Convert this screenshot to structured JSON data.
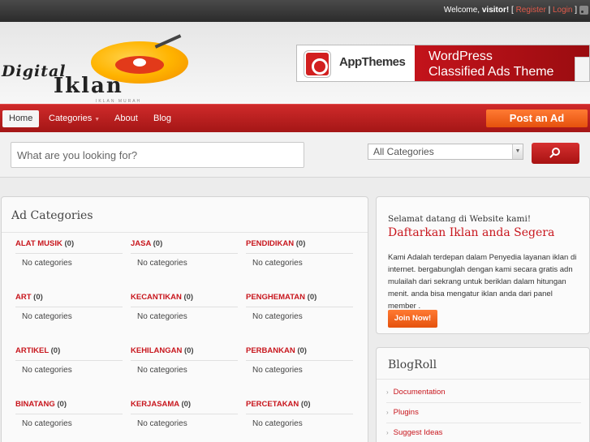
{
  "topbar": {
    "welcome_prefix": "Welcome, ",
    "username": "visitor!",
    "register_label": "Register",
    "login_label": "Login",
    "rss_icon": "rss-icon"
  },
  "logo": {
    "line1": "Digital",
    "line2": "Iklan",
    "tagline": "IKLAN MURAH"
  },
  "banner": {
    "brand": "AppThemes",
    "line1": "WordPress",
    "line2": "Classified Ads Theme"
  },
  "nav": {
    "items": [
      "Home",
      "Categories",
      "About",
      "Blog"
    ],
    "post_ad": "Post an Ad",
    "colors": {
      "nav_red": "#c0161d",
      "orange": "#f36a22"
    }
  },
  "search": {
    "placeholder": "What are you looking for?",
    "category_selected": "All Categories",
    "search_icon": "search-icon"
  },
  "categories": {
    "title": "Ad Categories",
    "columns": [
      [
        {
          "name": "ALAT MUSIK",
          "count": "(0)",
          "sub": "No categories"
        },
        {
          "name": "ART",
          "count": "(0)",
          "sub": "No categories"
        },
        {
          "name": "ARTIKEL",
          "count": "(0)",
          "sub": "No categories"
        },
        {
          "name": "BINATANG",
          "count": "(0)",
          "sub": "No categories"
        }
      ],
      [
        {
          "name": "JASA",
          "count": "(0)",
          "sub": "No categories"
        },
        {
          "name": "KECANTIKAN",
          "count": "(0)",
          "sub": "No categories"
        },
        {
          "name": "KEHILANGAN",
          "count": "(0)",
          "sub": "No categories"
        },
        {
          "name": "KERJASAMA",
          "count": "(0)",
          "sub": "No categories"
        }
      ],
      [
        {
          "name": "PENDIDIKAN",
          "count": "(0)",
          "sub": "No categories"
        },
        {
          "name": "PENGHEMATAN",
          "count": "(0)",
          "sub": "No categories"
        },
        {
          "name": "PERBANKAN",
          "count": "(0)",
          "sub": "No categories"
        },
        {
          "name": "PERCETAKAN",
          "count": "(0)",
          "sub": "No categories"
        }
      ]
    ]
  },
  "welcome_box": {
    "greeting": "Selamat datang di Website kami!",
    "headline": "Daftarkan Iklan anda Segera",
    "description": "Kami Adalah terdepan dalam Penyedia layanan iklan di internet. bergabunglah dengan kami secara gratis adn mulailah dari sekrang untuk beriklan dalam hitungan menit. anda bisa mengatur iklan anda dari panel member .",
    "join_label": "Join Now!"
  },
  "blogroll": {
    "title": "BlogRoll",
    "items": [
      "Documentation",
      "Plugins",
      "Suggest Ideas"
    ]
  }
}
